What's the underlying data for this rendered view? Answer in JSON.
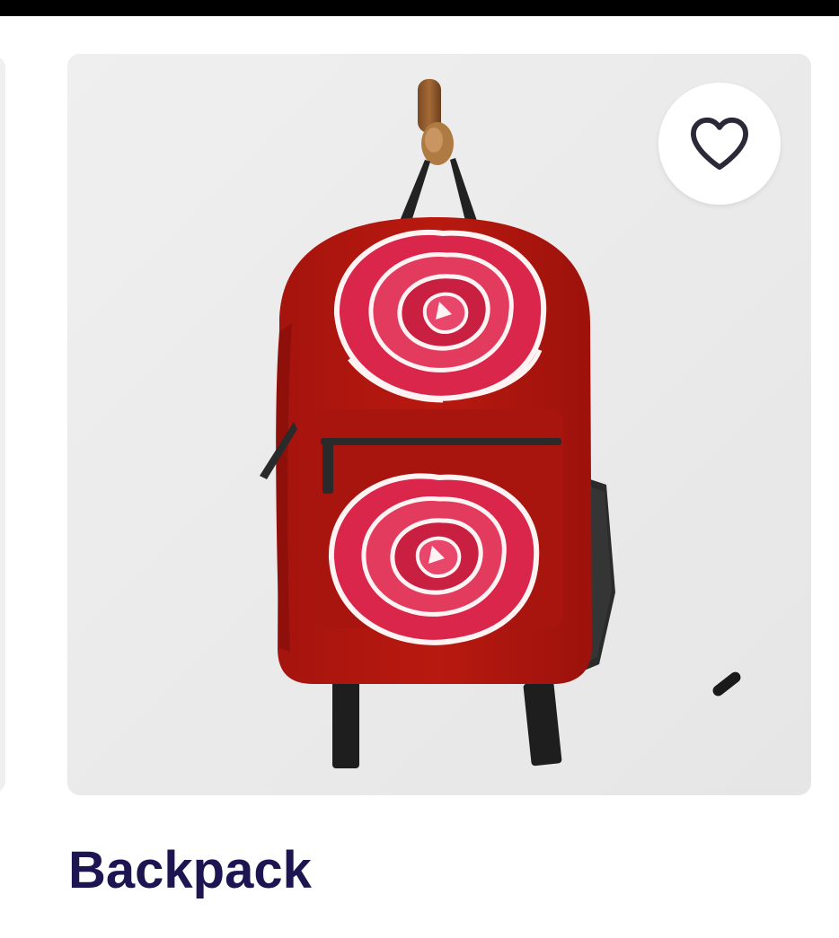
{
  "product": {
    "title": "Backpack",
    "image_description_icon": "rose-backpack-image",
    "favorite_icon": "heart-outline-icon"
  },
  "colors": {
    "title": "#1c1552",
    "backpack": "#b0160f",
    "rose": "#d9264a",
    "card_background": "#ececec"
  }
}
